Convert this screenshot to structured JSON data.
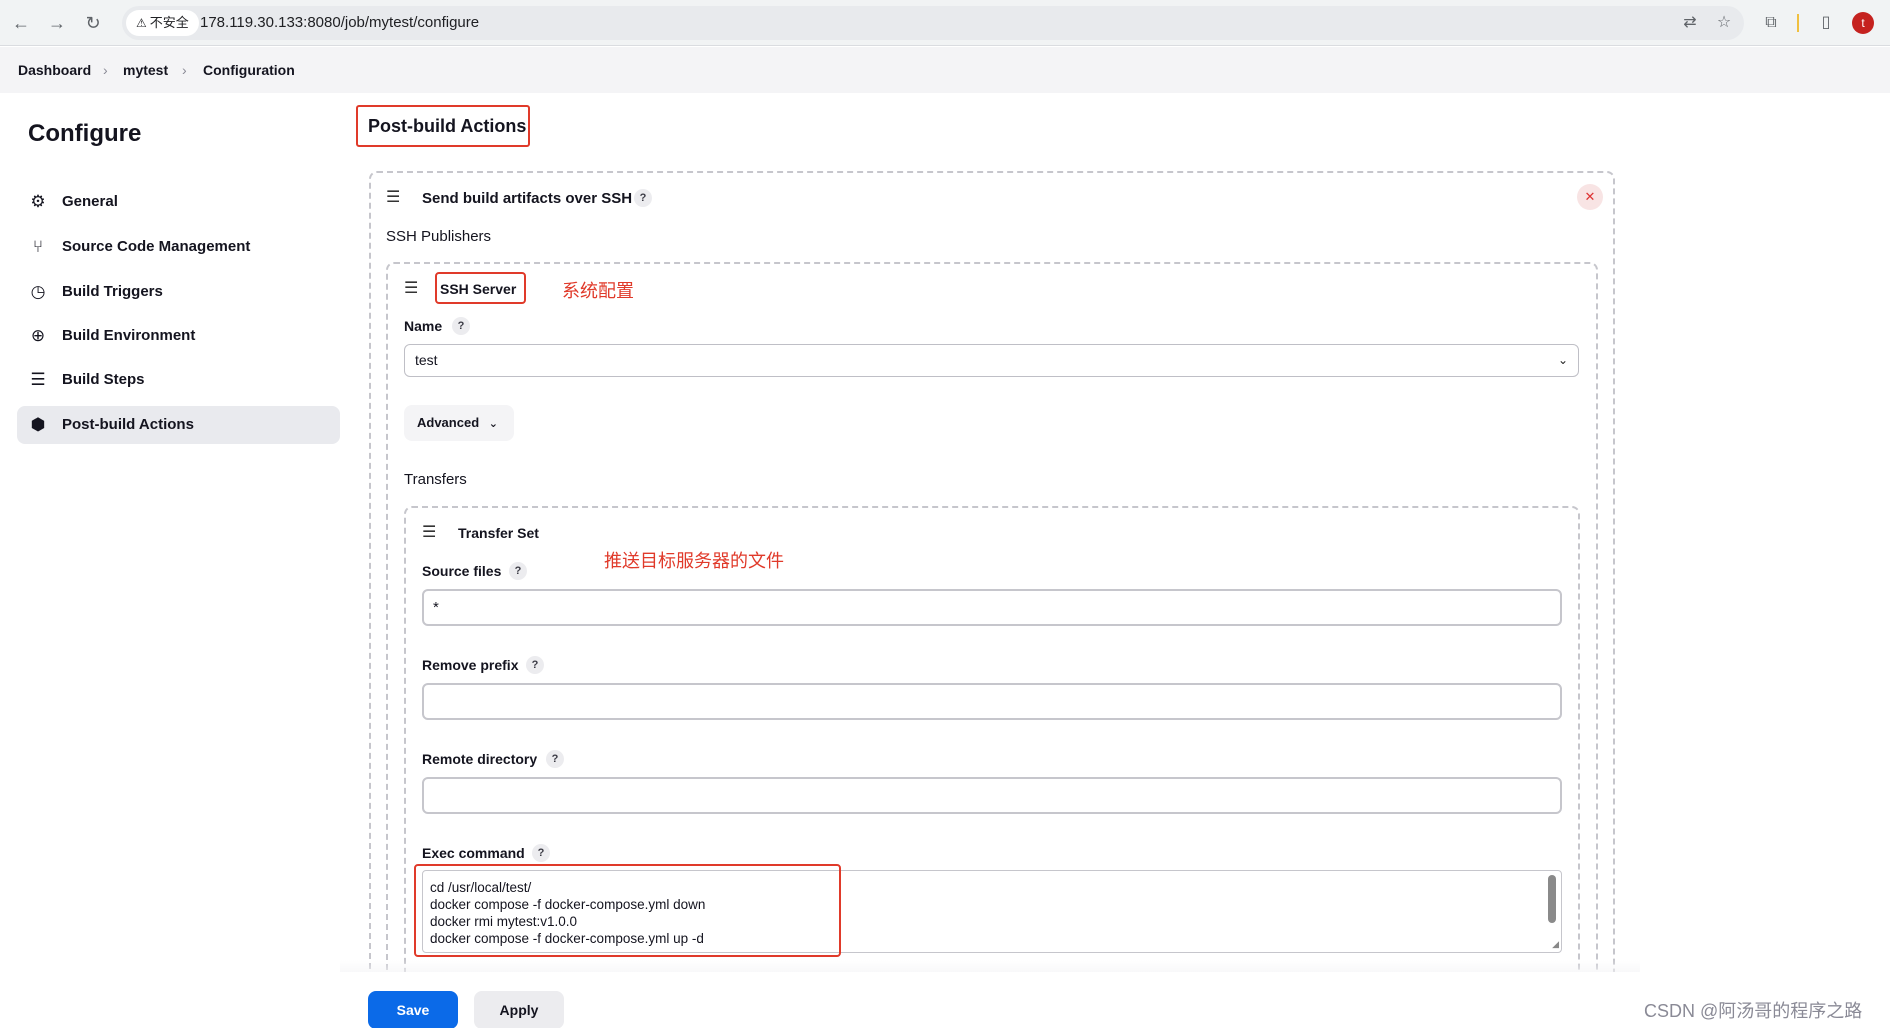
{
  "browser": {
    "security_label": "不安全",
    "url": "178.119.30.133:8080/job/mytest/configure",
    "avatar_letter": "t"
  },
  "breadcrumb": [
    "Dashboard",
    "mytest",
    "Configuration"
  ],
  "sidebar": {
    "title": "Configure",
    "items": [
      {
        "label": "General",
        "icon": "gear-icon",
        "active": false
      },
      {
        "label": "Source Code Management",
        "icon": "branch-icon",
        "active": false
      },
      {
        "label": "Build Triggers",
        "icon": "clock-icon",
        "active": false
      },
      {
        "label": "Build Environment",
        "icon": "globe-icon",
        "active": false
      },
      {
        "label": "Build Steps",
        "icon": "list-icon",
        "active": false
      },
      {
        "label": "Post-build Actions",
        "icon": "package-icon",
        "active": true
      }
    ]
  },
  "main": {
    "section_title": "Post-build Actions",
    "publisher": {
      "title": "Send build artifacts over SSH",
      "ssh_publishers_label": "SSH Publishers",
      "ssh_server": {
        "title": "SSH Server",
        "annotation": "系统配置",
        "name_label": "Name",
        "name_value": "test",
        "advanced_label": "Advanced"
      },
      "transfers_label": "Transfers",
      "transfer_set": {
        "title": "Transfer Set",
        "annotation": "推送目标服务器的文件",
        "source_files_label": "Source files",
        "source_files_value": "*",
        "remove_prefix_label": "Remove prefix",
        "remove_prefix_value": "",
        "remote_directory_label": "Remote directory",
        "remote_directory_value": "",
        "exec_command_label": "Exec command",
        "exec_command_lines": [
          "cd /usr/local/test/",
          "docker compose -f docker-compose.yml down",
          "docker rmi mytest:v1.0.0",
          "docker compose -f docker-compose.yml up -d"
        ]
      }
    }
  },
  "footer": {
    "save_label": "Save",
    "apply_label": "Apply"
  },
  "watermark": "CSDN @阿汤哥的程序之路",
  "colors": {
    "annotation_red": "#e03a2a",
    "primary_blue": "#0b6ae8"
  }
}
